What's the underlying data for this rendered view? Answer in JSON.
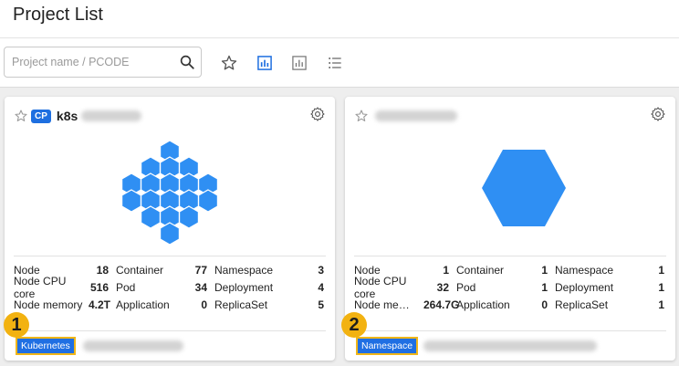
{
  "header": {
    "title": "Project List"
  },
  "search": {
    "placeholder": "Project name / PCODE",
    "value": ""
  },
  "toolbar": {
    "icons": [
      "star-icon",
      "bar-chart-icon",
      "bar-chart-outline-icon",
      "list-icon"
    ],
    "active_color": "#1e6fe0"
  },
  "cards": [
    {
      "badge": "CP",
      "name": "k8s",
      "stats": [
        [
          {
            "label": "Node",
            "value": "18"
          },
          {
            "label": "Container",
            "value": "77"
          },
          {
            "label": "Namespace",
            "value": "3"
          }
        ],
        [
          {
            "label": "Node CPU core",
            "value": "516"
          },
          {
            "label": "Pod",
            "value": "34"
          },
          {
            "label": "Deployment",
            "value": "4"
          }
        ],
        [
          {
            "label": "Node memory",
            "value": "4.2T"
          },
          {
            "label": "Application",
            "value": "0"
          },
          {
            "label": "ReplicaSet",
            "value": "5"
          }
        ]
      ],
      "tag": "Kubernetes",
      "marker": "1"
    },
    {
      "badge": "",
      "name": "",
      "stats": [
        [
          {
            "label": "Node",
            "value": "1"
          },
          {
            "label": "Container",
            "value": "1"
          },
          {
            "label": "Namespace",
            "value": "1"
          }
        ],
        [
          {
            "label": "Node CPU core",
            "value": "32"
          },
          {
            "label": "Pod",
            "value": "1"
          },
          {
            "label": "Deployment",
            "value": "1"
          }
        ],
        [
          {
            "label": "Node me…",
            "value": "264.7G"
          },
          {
            "label": "Application",
            "value": "0"
          },
          {
            "label": "ReplicaSet",
            "value": "1"
          }
        ]
      ],
      "tag": "Namespace",
      "marker": "2"
    }
  ],
  "colors": {
    "hex_fill": "#2f8ff3",
    "tag_bg": "#1f6fe3",
    "marker": "#f2b211"
  }
}
